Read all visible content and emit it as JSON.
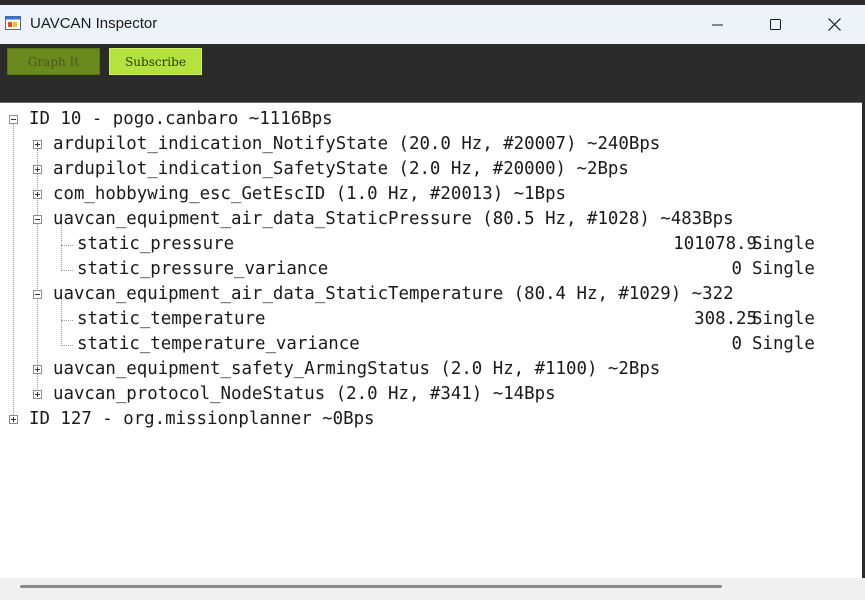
{
  "window": {
    "title": "UAVCAN Inspector",
    "icons": {
      "app": "app-window-icon",
      "minimize": "minimize-icon",
      "maximize": "maximize-icon",
      "close": "close-icon"
    }
  },
  "toolbar": {
    "graph_label": "Graph It",
    "subscribe_label": "Subscribe"
  },
  "tree": {
    "nodes": [
      {
        "label": "ID 10 - pogo.canbaro ~1116Bps",
        "children": [
          {
            "label": "ardupilot_indication_NotifyState (20.0 Hz, #20007) ~240Bps"
          },
          {
            "label": "ardupilot_indication_SafetyState (2.0 Hz, #20000) ~2Bps"
          },
          {
            "label": "com_hobbywing_esc_GetEscID (1.0 Hz, #20013) ~1Bps"
          },
          {
            "label": "uavcan_equipment_air_data_StaticPressure (80.5 Hz, #1028) ~483Bps",
            "fields": [
              {
                "name": "static_pressure",
                "value": "101078.9",
                "type": "Single"
              },
              {
                "name": "static_pressure_variance",
                "value": "0",
                "type": "Single"
              }
            ]
          },
          {
            "label": "uavcan_equipment_air_data_StaticTemperature (80.4 Hz, #1029) ~322",
            "fields": [
              {
                "name": "static_temperature",
                "value": "308.25",
                "type": "Single"
              },
              {
                "name": "static_temperature_variance",
                "value": "0",
                "type": "Single"
              }
            ]
          },
          {
            "label": "uavcan_equipment_safety_ArmingStatus (2.0 Hz, #1100) ~2Bps"
          },
          {
            "label": "uavcan_protocol_NodeStatus (2.0 Hz, #341) ~14Bps"
          }
        ]
      },
      {
        "label": "ID 127 - org.missionplanner ~0Bps"
      }
    ]
  },
  "colors": {
    "toolbar_bg": "#2b2b2b",
    "graph_button": "#6b8a1e",
    "subscribe_button": "#b5e23d",
    "titlebar_bg": "#eef2f9"
  }
}
